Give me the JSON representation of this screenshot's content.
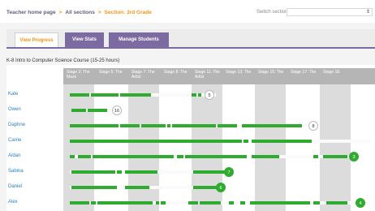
{
  "breadcrumb": {
    "home": "Teacher home page",
    "sections": "All sections",
    "current": "Section: 3rd Grade"
  },
  "switch_section": {
    "label": "Switch section:",
    "value": ""
  },
  "tabs": [
    {
      "label": "View Progress",
      "active": true
    },
    {
      "label": "View Stats",
      "active": false
    },
    {
      "label": "Manage Students",
      "active": false
    }
  ],
  "course_title": "K-8 Intro to Computer Science Course (15-25 hours)",
  "stages": [
    "Stage 2: The Maze",
    "Stage 5: The",
    "Stage 7: The Artist",
    "Stage 8: The",
    "Stage 11: The Artist",
    "Stage 13: The",
    "Stage 15: The",
    "Stage 17: The",
    "Stage 18:"
  ],
  "students": [
    {
      "name": "Kate",
      "badge": "5",
      "complete": false
    },
    {
      "name": "Owen",
      "badge": "16",
      "complete": false
    },
    {
      "name": "Daphne",
      "badge": "8",
      "complete": false
    },
    {
      "name": "Carrie",
      "badge": "",
      "complete": false
    },
    {
      "name": "Aidan",
      "badge": "3",
      "complete": true
    },
    {
      "name": "Sabina",
      "badge": "7",
      "complete": true
    },
    {
      "name": "Daniel",
      "badge": "6",
      "complete": true
    },
    {
      "name": "Alex",
      "badge": "4",
      "complete": true
    }
  ],
  "colors": {
    "accent_orange": "#f79412",
    "tab_purple": "#7b6ba1",
    "progress_green": "#2fac2f",
    "name_blue": "#2a7fbc"
  }
}
